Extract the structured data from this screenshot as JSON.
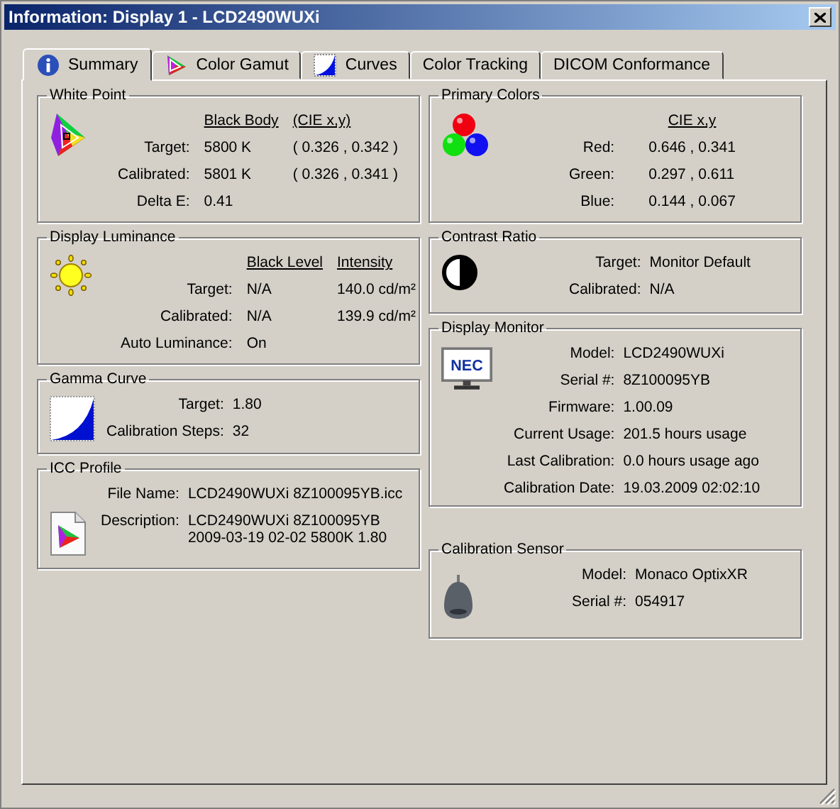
{
  "window": {
    "title": "Information: Display 1 - LCD2490WUXi"
  },
  "tabs": [
    {
      "label": "Summary",
      "kind": "info",
      "selected": true
    },
    {
      "label": "Color Gamut",
      "kind": "gamut",
      "selected": false
    },
    {
      "label": "Curves",
      "kind": "curve",
      "selected": false
    },
    {
      "label": "Color Tracking",
      "kind": "text",
      "selected": false
    },
    {
      "label": "DICOM Conformance",
      "kind": "text",
      "selected": false
    }
  ],
  "left_groups": [
    {
      "title": "White Point",
      "kind": "gamut",
      "headers": [
        "Black Body",
        "(CIE x,y)"
      ],
      "rows": [
        {
          "label": "Target:",
          "values": [
            "5800 K",
            "( 0.326 , 0.342 )"
          ]
        },
        {
          "label": "Calibrated:",
          "values": [
            "5801 K",
            "( 0.326 , 0.341 )"
          ]
        },
        {
          "label": "Delta E:",
          "values": [
            "0.41"
          ]
        }
      ]
    },
    {
      "title": "Display Luminance",
      "kind": "sun",
      "headers": [
        "Black Level",
        "Intensity"
      ],
      "rows": [
        {
          "label": "Target:",
          "values": [
            "N/A",
            "140.0 cd/m²"
          ]
        },
        {
          "label": "Calibrated:",
          "values": [
            "N/A",
            "139.9 cd/m²"
          ]
        },
        {
          "label": "Auto Luminance:",
          "values": [
            "On"
          ]
        }
      ]
    },
    {
      "title": "Gamma Curve",
      "kind": "gamma",
      "rows": [
        {
          "label": "Target:",
          "values": [
            "1.80"
          ]
        },
        {
          "label": "Calibration Steps:",
          "values": [
            "32"
          ]
        }
      ]
    },
    {
      "title": "ICC Profile",
      "kind": "icc",
      "rows": [
        {
          "label": "File Name:",
          "values": [
            "LCD2490WUXi 8Z100095YB.icc"
          ]
        },
        {
          "label": "Description:",
          "values": [
            "LCD2490WUXi 8Z100095YB\n2009-03-19 02-02 5800K 1.80"
          ]
        }
      ]
    }
  ],
  "right_groups": [
    {
      "title": "Primary Colors",
      "kind": "spheres",
      "headers": [
        "CIE x,y"
      ],
      "rows": [
        {
          "label": "Red:",
          "values": [
            "0.646 , 0.341"
          ]
        },
        {
          "label": "Green:",
          "values": [
            "0.297 , 0.611"
          ]
        },
        {
          "label": "Blue:",
          "values": [
            "0.144 , 0.067"
          ]
        }
      ]
    },
    {
      "title": "Contrast Ratio",
      "kind": "contrast",
      "rows": [
        {
          "label": "Target:",
          "values": [
            "Monitor Default"
          ]
        },
        {
          "label": "Calibrated:",
          "values": [
            "N/A"
          ]
        }
      ]
    },
    {
      "title": "Display Monitor",
      "kind": "monitor",
      "logo": "NEC",
      "rows": [
        {
          "label": "Model:",
          "values": [
            "LCD2490WUXi"
          ]
        },
        {
          "label": "Serial #:",
          "values": [
            "8Z100095YB"
          ]
        },
        {
          "label": "Firmware:",
          "values": [
            "1.00.09"
          ]
        },
        {
          "label": "Current Usage:",
          "values": [
            "201.5 hours usage"
          ]
        },
        {
          "label": "Last Calibration:",
          "values": [
            "0.0 hours usage ago"
          ]
        },
        {
          "label": "Calibration Date:",
          "values": [
            "19.03.2009 02:02:10"
          ]
        }
      ]
    },
    {
      "title": "Calibration Sensor",
      "kind": "sensor",
      "rows": [
        {
          "label": "Model:",
          "values": [
            "Monaco OptixXR"
          ]
        },
        {
          "label": "Serial #:",
          "values": [
            "054917"
          ]
        }
      ]
    }
  ]
}
